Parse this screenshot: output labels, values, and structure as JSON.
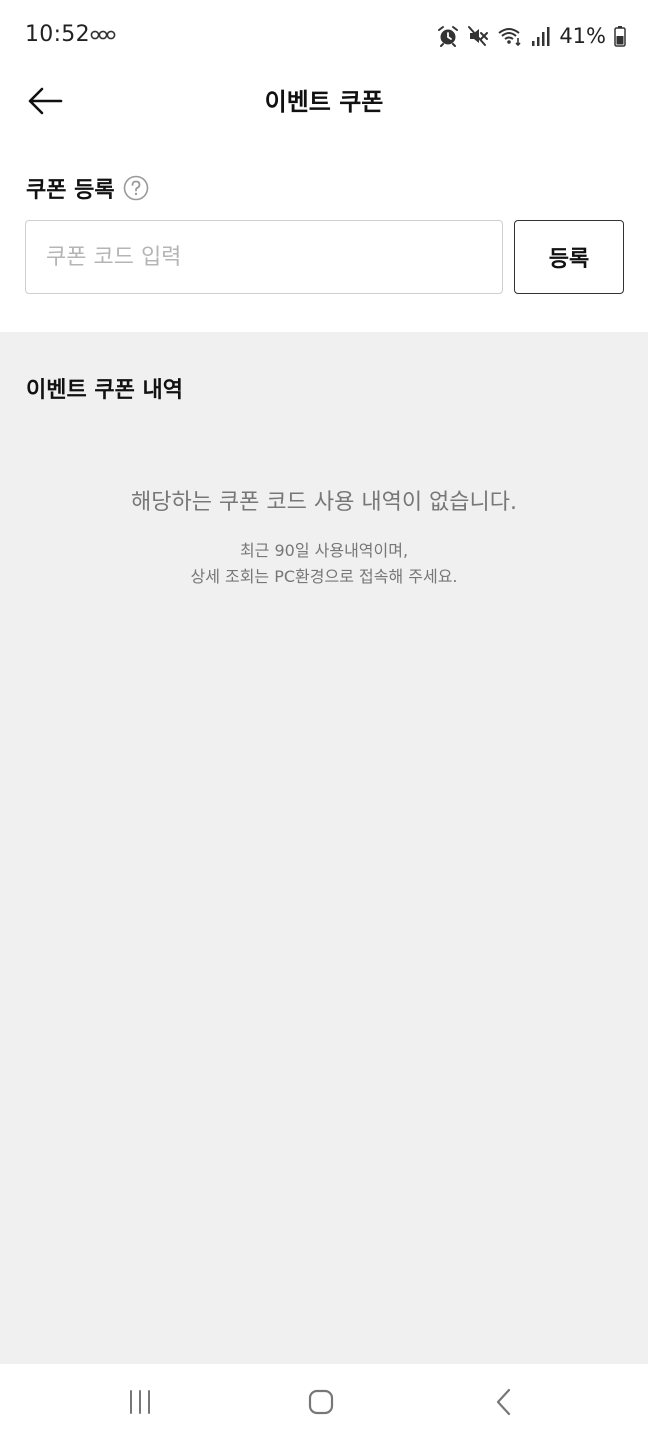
{
  "status_bar": {
    "time": "10:52",
    "battery_percent": "41%",
    "icons": [
      "alarm-icon",
      "mute-icon",
      "wifi-icon",
      "signal-icon",
      "battery-icon"
    ]
  },
  "header": {
    "title": "이벤트 쿠폰",
    "back_icon": "arrow-left-icon"
  },
  "register": {
    "title": "쿠폰 등록",
    "help_icon": "question-circle-icon",
    "input_placeholder": "쿠폰 코드 입력",
    "input_value": "",
    "button_label": "등록"
  },
  "history": {
    "title": "이벤트 쿠폰 내역",
    "empty_message": "해당하는 쿠폰 코드 사용 내역이 없습니다.",
    "empty_sub_line1": "최근 90일 사용내역이며,",
    "empty_sub_line2": "상세 조회는 PC환경으로 접속해 주세요."
  },
  "nav": {
    "recent_icon": "recent-apps-icon",
    "home_icon": "home-icon",
    "back_icon": "chevron-left-icon"
  },
  "colors": {
    "background": "#f0f0f0",
    "surface": "#ffffff",
    "text_primary": "#111111",
    "text_secondary": "#777777",
    "placeholder": "#b5b5b5",
    "border": "#cfcfcf"
  }
}
